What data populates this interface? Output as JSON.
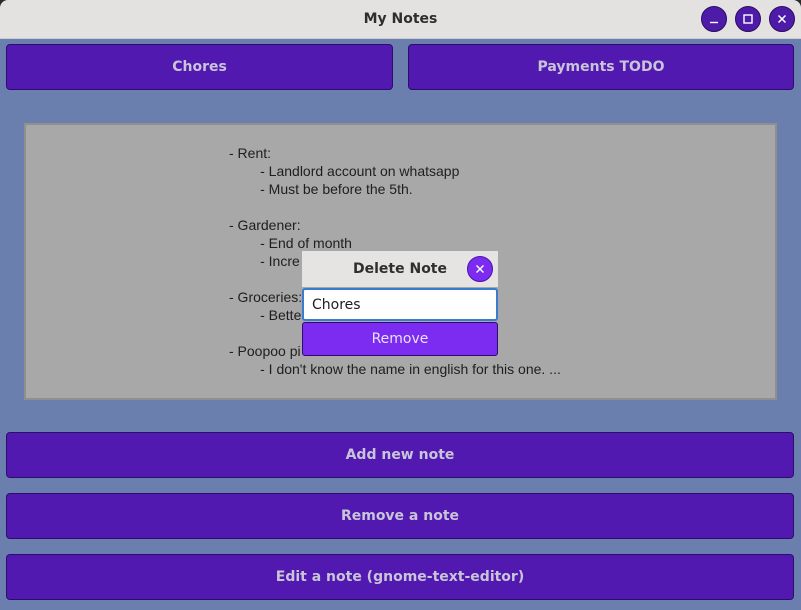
{
  "window": {
    "title": "My Notes",
    "controls": {
      "minimize_icon": "minimize-icon",
      "maximize_icon": "maximize-icon",
      "close_icon": "close-icon"
    }
  },
  "tabs": [
    {
      "label": "Chores"
    },
    {
      "label": "Payments TODO"
    }
  ],
  "note": {
    "text": "- Rent:\n        - Landlord account on whatsapp\n        - Must be before the 5th.\n\n- Gardener:\n        - End of month\n        - Incre\n\n- Groceries:\n        - Bette\n\n- Poopoo pi\n        - I don't know the name in english for this one. ..."
  },
  "dialog": {
    "title": "Delete Note",
    "input_value": "Chores",
    "remove_label": "Remove",
    "close_icon": "close-icon"
  },
  "actions": {
    "add_label": "Add new note",
    "remove_label": "Remove a note",
    "edit_label": "Edit a note (gnome-text-editor)"
  },
  "colors": {
    "window_bg": "#6b7fae",
    "button": "#5219b0",
    "accent": "#7b2cf0",
    "note_bg": "#a8a8a8",
    "titlebar": "#e4e2e0"
  }
}
